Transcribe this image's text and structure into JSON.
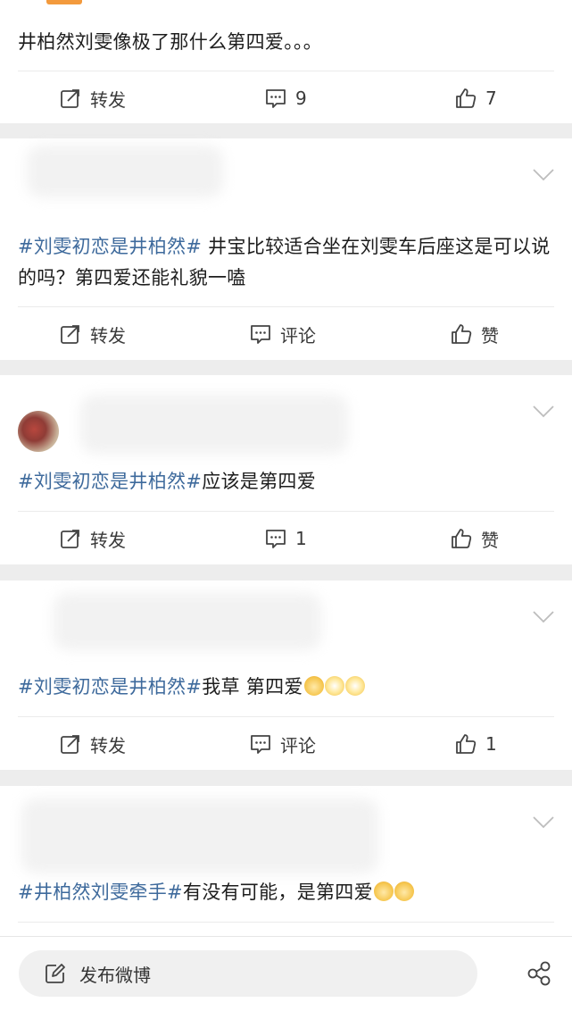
{
  "posts": [
    {
      "text_plain": "井柏然刘雯像极了那什么第四爱。。。",
      "actions": {
        "repost": "转发",
        "comment": "9",
        "like": "7"
      }
    },
    {
      "hashtag": "#刘雯初恋是井柏然#",
      "text": " 井宝比较适合坐在刘雯车后座这是可以说的吗？第四爱还能礼貌一嗑",
      "actions": {
        "repost": "转发",
        "comment": "评论",
        "like": "赞"
      }
    },
    {
      "hashtag": "#刘雯初恋是井柏然#",
      "text": "应该是第四爱",
      "actions": {
        "repost": "转发",
        "comment": "1",
        "like": "赞"
      }
    },
    {
      "hashtag": "#刘雯初恋是井柏然#",
      "text": "我草 第四爱",
      "actions": {
        "repost": "转发",
        "comment": "评论",
        "like": "1"
      }
    },
    {
      "hashtag": "#井柏然刘雯牵手#",
      "text": "有没有可能，是第四爱",
      "actions": {}
    }
  ],
  "bottom_bar": {
    "compose_label": "发布微博"
  },
  "icons": {
    "repost": "repost-icon",
    "comment": "comment-icon",
    "like": "thumbs-up-icon",
    "chevron": "chevron-down-icon",
    "share": "share-icon",
    "compose": "edit-icon"
  },
  "colors": {
    "hashtag": "#3e6a9c",
    "accent": "#f39a3d"
  }
}
